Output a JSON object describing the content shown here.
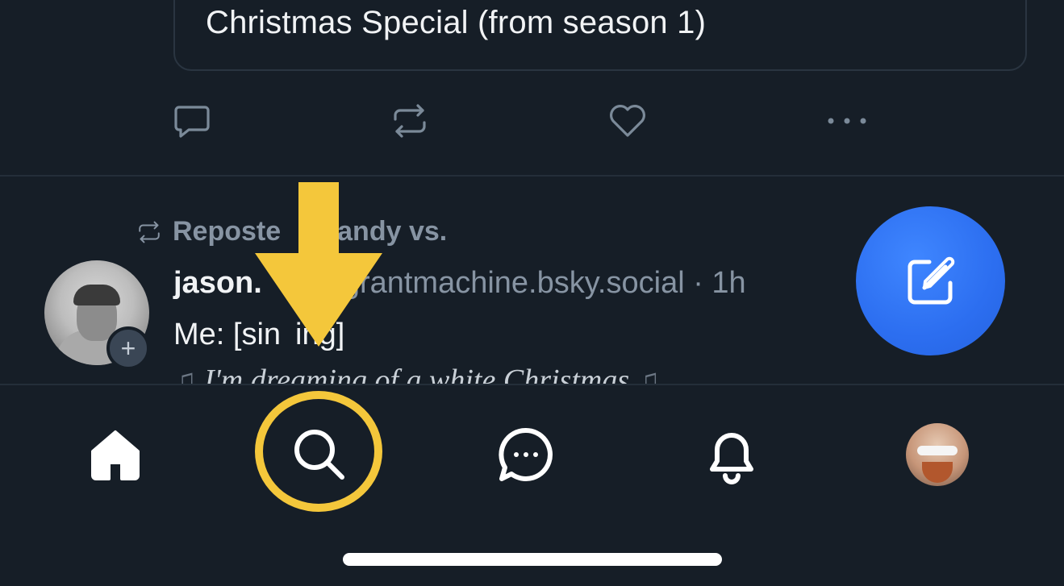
{
  "embed": {
    "text": "Christmas Special (from season 1)"
  },
  "actions": {
    "reply_icon": "comment-icon",
    "repost_icon": "repost-icon",
    "like_icon": "heart-icon",
    "more_icon": "more-icon"
  },
  "post": {
    "repost_label": "Reposte",
    "repost_label_tail": "andy vs.",
    "author_name": "jason.",
    "author_handle_tail": "grantmachine.bsky.social",
    "separator": " · ",
    "time": "1h",
    "text_line1_pre": "Me: [sin",
    "text_line1_post": "ing]",
    "text_line2": "I'm dreaming of a white Christmas",
    "follow_symbol": "+"
  },
  "fab": {
    "icon": "compose-icon"
  },
  "tab_bar": {
    "tabs": [
      "home-icon",
      "search-icon",
      "chat-icon",
      "bell-icon",
      "profile-avatar"
    ],
    "highlighted": "search"
  },
  "colors": {
    "background": "#161e27",
    "accent": "#2c6ef0",
    "annotation": "#f4c73b",
    "muted": "#8794a3"
  }
}
